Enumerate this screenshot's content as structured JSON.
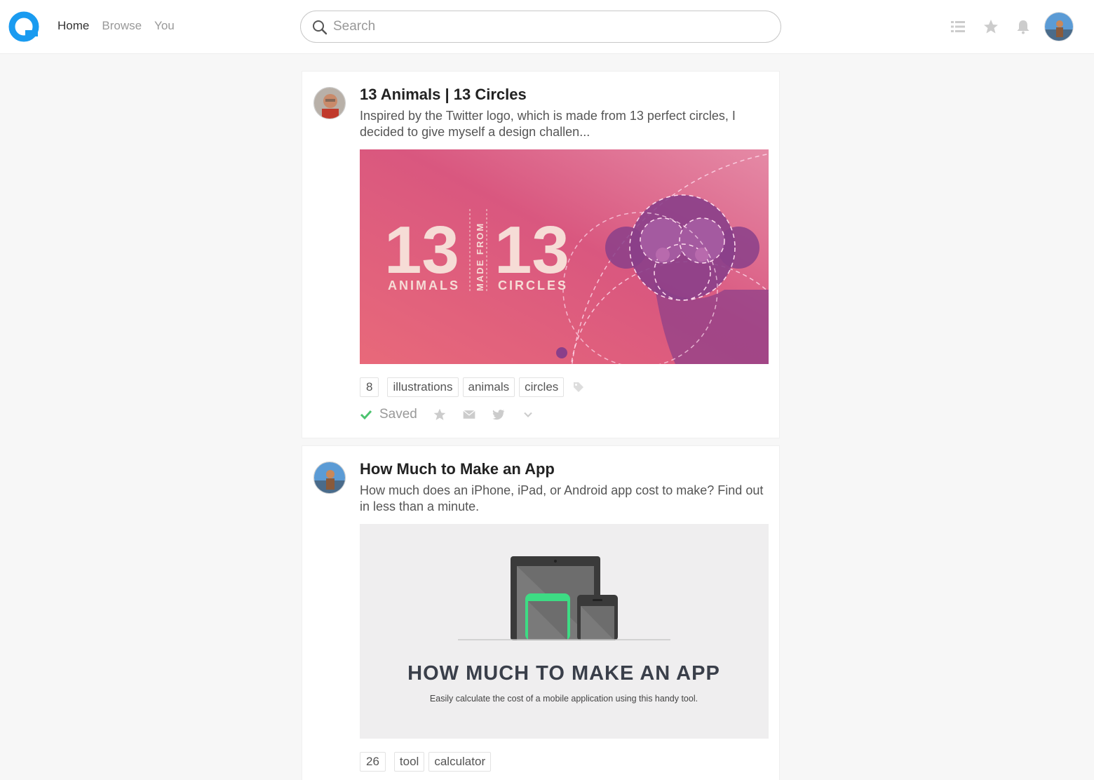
{
  "nav": {
    "home": "Home",
    "browse": "Browse",
    "you": "You"
  },
  "search": {
    "placeholder": "Search"
  },
  "colors": {
    "brand": "#1a9bf0",
    "saved_check": "#4cc36f",
    "hero1_bg": "#e0667a",
    "hero2_bg": "#efeeef"
  },
  "icons": {
    "logo": "logo-icon",
    "search": "search-icon",
    "list": "list-icon",
    "favorites": "star-icon",
    "notifications": "bell-icon"
  },
  "posts": [
    {
      "title": "13 Animals | 13 Circles",
      "description": "Inspired by the Twitter logo, which is made from 13 perfect circles, I decided to give myself a design challen...",
      "image": {
        "left_number": "13",
        "left_caption": "ANIMALS",
        "middle_caption": "MADE FROM",
        "right_number": "13",
        "right_caption": "CIRCLES"
      },
      "count": "8",
      "tags": [
        "illustrations",
        "animals",
        "circles"
      ],
      "saved_label": "Saved"
    },
    {
      "title": "How Much to Make an App",
      "description": "How much does an iPhone, iPad, or Android app cost to make? Find out in less than a minute.",
      "image": {
        "headline": "HOW MUCH TO MAKE AN APP",
        "subline": "Easily calculate the cost of a mobile application using this handy tool."
      },
      "count": "26",
      "tags": [
        "tool",
        "calculator"
      ]
    }
  ]
}
